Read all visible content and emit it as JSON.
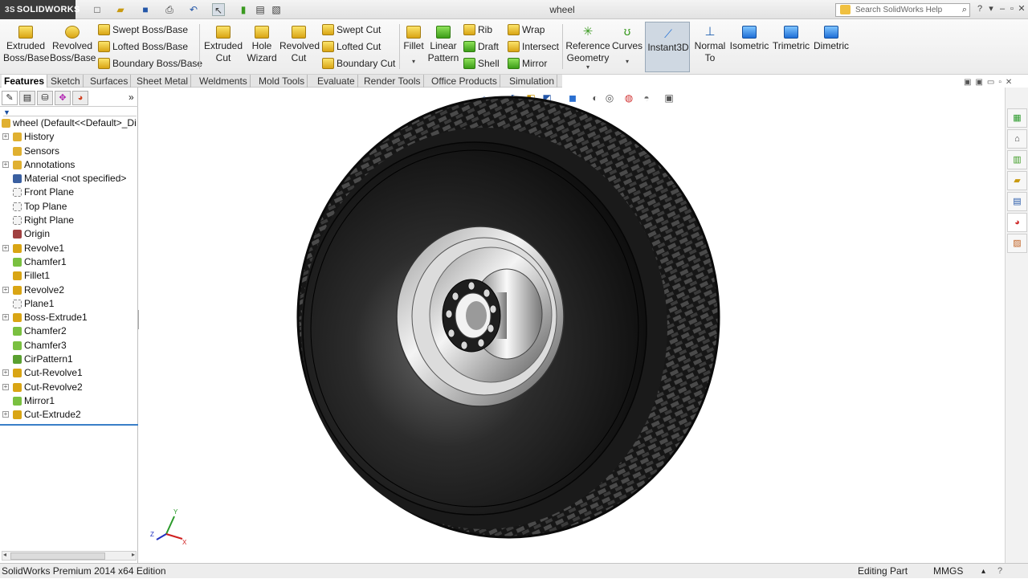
{
  "titlebar": {
    "logo": "SOLIDWORKS",
    "logo_mark": "3S",
    "document_title": "wheel",
    "search_placeholder": "Search SolidWorks Help",
    "quick_access": [
      "new-icon",
      "open-icon",
      "save-icon",
      "print-icon",
      "undo-icon",
      "select-icon",
      "rebuild-icon",
      "file-properties-icon",
      "options-icon"
    ]
  },
  "command_manager": {
    "extruded_boss": "Extruded Boss/Base",
    "revolved_boss": "Revolved Boss/Base",
    "swept_boss": "Swept Boss/Base",
    "lofted_boss": "Lofted Boss/Base",
    "boundary_boss": "Boundary Boss/Base",
    "extruded_cut": "Extruded Cut",
    "hole_wizard": "Hole Wizard",
    "revolved_cut": "Revolved Cut",
    "swept_cut": "Swept Cut",
    "lofted_cut": "Lofted Cut",
    "boundary_cut": "Boundary Cut",
    "fillet": "Fillet",
    "linear_pattern": "Linear Pattern",
    "rib": "Rib",
    "draft": "Draft",
    "shell": "Shell",
    "wrap": "Wrap",
    "intersect": "Intersect",
    "mirror": "Mirror",
    "reference_geometry": "Reference Geometry",
    "curves": "Curves",
    "instant3d": "Instant3D",
    "normal_to": "Normal To",
    "isometric": "Isometric",
    "trimetric": "Trimetric",
    "dimetric": "Dimetric"
  },
  "tabs": [
    "Features",
    "Sketch",
    "Surfaces",
    "Sheet Metal",
    "Weldments",
    "Mold Tools",
    "Evaluate",
    "Render Tools",
    "Office Products",
    "Simulation"
  ],
  "feature_tree": {
    "root": "wheel  (Default<<Default>_Di",
    "items": [
      {
        "label": "History",
        "icon": "history-icon",
        "expandable": true
      },
      {
        "label": "Sensors",
        "icon": "sensors-icon",
        "expandable": false
      },
      {
        "label": "Annotations",
        "icon": "annotations-icon",
        "expandable": true
      },
      {
        "label": "Material <not specified>",
        "icon": "material-icon",
        "expandable": false
      },
      {
        "label": "Front Plane",
        "icon": "plane-icon",
        "expandable": false
      },
      {
        "label": "Top Plane",
        "icon": "plane-icon",
        "expandable": false
      },
      {
        "label": "Right Plane",
        "icon": "plane-icon",
        "expandable": false
      },
      {
        "label": "Origin",
        "icon": "origin-icon",
        "expandable": false
      },
      {
        "label": "Revolve1",
        "icon": "revolve-icon",
        "expandable": true
      },
      {
        "label": "Chamfer1",
        "icon": "chamfer-icon",
        "expandable": false
      },
      {
        "label": "Fillet1",
        "icon": "fillet-icon",
        "expandable": false
      },
      {
        "label": "Revolve2",
        "icon": "revolve-icon",
        "expandable": true
      },
      {
        "label": "Plane1",
        "icon": "plane-icon",
        "expandable": false
      },
      {
        "label": "Boss-Extrude1",
        "icon": "extrude-icon",
        "expandable": true
      },
      {
        "label": "Chamfer2",
        "icon": "chamfer-icon",
        "expandable": false
      },
      {
        "label": "Chamfer3",
        "icon": "chamfer-icon",
        "expandable": false
      },
      {
        "label": "CirPattern1",
        "icon": "circular-pattern-icon",
        "expandable": false
      },
      {
        "label": "Cut-Revolve1",
        "icon": "cut-revolve-icon",
        "expandable": true
      },
      {
        "label": "Cut-Revolve2",
        "icon": "cut-revolve-icon",
        "expandable": true
      },
      {
        "label": "Mirror1",
        "icon": "mirror-icon",
        "expandable": false
      },
      {
        "label": "Cut-Extrude2",
        "icon": "cut-extrude-icon",
        "expandable": true
      }
    ]
  },
  "triad": {
    "x": "X",
    "y": "Y",
    "z": "Z"
  },
  "statusbar": {
    "edition": "SolidWorks Premium 2014 x64 Edition",
    "mode": "Editing Part",
    "units": "MMGS"
  },
  "colors": {
    "tire": "#1c1c1c",
    "rim": "#c8c8c8",
    "selection": "#cfd8e2"
  }
}
